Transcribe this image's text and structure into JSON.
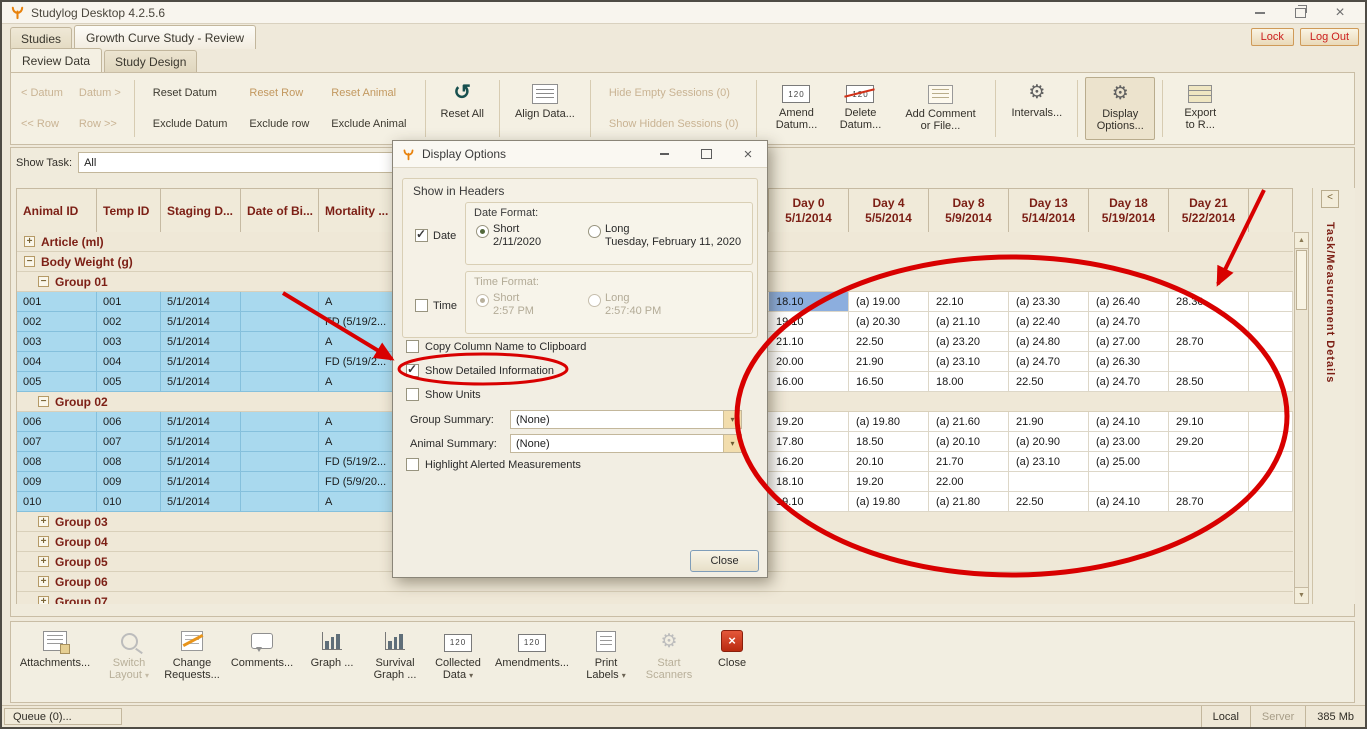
{
  "window": {
    "title": "Studylog Desktop 4.2.5.6"
  },
  "header_tabs": {
    "studies": "Studies",
    "study_review": "Growth Curve Study - Review",
    "lock": "Lock",
    "log_out": "Log Out"
  },
  "view_tabs": {
    "review_data": "Review Data",
    "study_design": "Study Design"
  },
  "toolbar": {
    "datum_prev": "< Datum",
    "datum_next": "Datum >",
    "row_prev": "<< Row",
    "row_next": "Row >>",
    "reset_datum": "Reset Datum",
    "exclude_datum": "Exclude Datum",
    "reset_row": "Reset Row",
    "exclude_row": "Exclude row",
    "reset_animal": "Reset Animal",
    "exclude_animal": "Exclude Animal",
    "reset_all": "Reset All",
    "align_data": "Align Data...",
    "hide_empty_sessions": "Hide Empty Sessions (0)",
    "show_hidden_sessions": "Show Hidden Sessions (0)",
    "amend_datum": "Amend Datum...",
    "delete_datum": "Delete Datum...",
    "add_comment": "Add Comment or File...",
    "intervals": "Intervals...",
    "display_options": "Display Options...",
    "export_to_r": "Export to R..."
  },
  "filter_bar": {
    "label": "Show Task:",
    "value": "All"
  },
  "grid": {
    "left_headers": [
      "Animal ID",
      "Temp ID",
      "Staging D...",
      "Date of Bi...",
      "Mortality ..."
    ],
    "day_headers": [
      {
        "day": "Day 0",
        "date": "5/1/2014"
      },
      {
        "day": "Day 4",
        "date": "5/5/2014"
      },
      {
        "day": "Day 8",
        "date": "5/9/2014"
      },
      {
        "day": "Day 13",
        "date": "5/14/2014"
      },
      {
        "day": "Day 18",
        "date": "5/19/2014"
      },
      {
        "day": "Day 21",
        "date": "5/22/2014"
      }
    ],
    "tasks": [
      {
        "label": "Article (ml)",
        "expanded": false,
        "groups": []
      },
      {
        "label": "Body Weight (g)",
        "expanded": true,
        "groups": [
          {
            "label": "Group 01",
            "expanded": true,
            "animals": [
              {
                "animal_id": "001",
                "temp_id": "001",
                "staging_date": "5/1/2014",
                "birth_date": "",
                "mortality": "A",
                "values": [
                  "18.10",
                  "(a) 19.00",
                  "22.10",
                  "(a) 23.30",
                  "(a) 26.40",
                  "28.30"
                ],
                "selected_col": 0
              },
              {
                "animal_id": "002",
                "temp_id": "002",
                "staging_date": "5/1/2014",
                "birth_date": "",
                "mortality": "FD (5/19/2...",
                "values": [
                  "19.10",
                  "(a) 20.30",
                  "(a) 21.10",
                  "(a) 22.40",
                  "(a) 24.70",
                  ""
                ]
              },
              {
                "animal_id": "003",
                "temp_id": "003",
                "staging_date": "5/1/2014",
                "birth_date": "",
                "mortality": "A",
                "values": [
                  "21.10",
                  "22.50",
                  "(a) 23.20",
                  "(a) 24.80",
                  "(a) 27.00",
                  "28.70"
                ]
              },
              {
                "animal_id": "004",
                "temp_id": "004",
                "staging_date": "5/1/2014",
                "birth_date": "",
                "mortality": "FD (5/19/2...",
                "values": [
                  "20.00",
                  "21.90",
                  "(a) 23.10",
                  "(a) 24.70",
                  "(a) 26.30",
                  ""
                ]
              },
              {
                "animal_id": "005",
                "temp_id": "005",
                "staging_date": "5/1/2014",
                "birth_date": "",
                "mortality": "A",
                "values": [
                  "16.00",
                  "16.50",
                  "18.00",
                  "22.50",
                  "(a) 24.70",
                  "28.50"
                ]
              }
            ]
          },
          {
            "label": "Group 02",
            "expanded": true,
            "animals": [
              {
                "animal_id": "006",
                "temp_id": "006",
                "staging_date": "5/1/2014",
                "birth_date": "",
                "mortality": "A",
                "values": [
                  "19.20",
                  "(a) 19.80",
                  "(a) 21.60",
                  "21.90",
                  "(a) 24.10",
                  "29.10"
                ]
              },
              {
                "animal_id": "007",
                "temp_id": "007",
                "staging_date": "5/1/2014",
                "birth_date": "",
                "mortality": "A",
                "values": [
                  "17.80",
                  "18.50",
                  "(a) 20.10",
                  "(a) 20.90",
                  "(a) 23.00",
                  "29.20"
                ]
              },
              {
                "animal_id": "008",
                "tem_id_note": "",
                "temp_id": "008",
                "staging_date": "5/1/2014",
                "birth_date": "",
                "mortality": "FD (5/19/2...",
                "values": [
                  "16.20",
                  "20.10",
                  "21.70",
                  "(a) 23.10",
                  "(a) 25.00",
                  ""
                ]
              },
              {
                "animal_id": "009",
                "temp_id": "009",
                "staging_date": "5/1/2014",
                "birth_date": "",
                "mortality": "FD (5/9/20...",
                "values": [
                  "18.10",
                  "19.20",
                  "22.00",
                  "",
                  "",
                  ""
                ]
              },
              {
                "animal_id": "010",
                "temp_id": "010",
                "staging_date": "5/1/2014",
                "birth_date": "",
                "mortality": "A",
                "values": [
                  "19.10",
                  "(a) 19.80",
                  "(a) 21.80",
                  "22.50",
                  "(a) 24.10",
                  "28.70"
                ]
              }
            ]
          },
          {
            "label": "Group 03",
            "expanded": false,
            "animals": []
          },
          {
            "label": "Group 04",
            "expanded": false,
            "animals": []
          },
          {
            "label": "Group 05",
            "expanded": false,
            "animals": []
          },
          {
            "label": "Group 06",
            "expanded": false,
            "animals": []
          },
          {
            "label": "Group 07",
            "expanded": false,
            "animals": []
          }
        ]
      }
    ]
  },
  "side_panel": {
    "title": "Task/Measurement Details"
  },
  "dialog": {
    "title": "Display Options",
    "show_in_headers": "Show in Headers",
    "date_checkbox": "Date",
    "date_format_label": "Date Format:",
    "short_label": "Short",
    "long_label": "Long",
    "date_short_value": "2/11/2020",
    "date_long_value": "Tuesday, February 11, 2020",
    "time_checkbox": "Time",
    "time_format_label": "Time Format:",
    "time_short_value": "2:57 PM",
    "time_long_value": "2:57:40 PM",
    "copy_column_name": "Copy Column Name to Clipboard",
    "show_detailed_information": "Show Detailed Information",
    "show_units": "Show Units",
    "group_summary_label": "Group Summary:",
    "group_summary_value": "(None)",
    "animal_summary_label": "Animal Summary:",
    "animal_summary_value": "(None)",
    "highlight_alerted": "Highlight Alerted Measurements",
    "close_button": "Close"
  },
  "bottom_toolbar": [
    {
      "label": "Attachments...",
      "icon": "attachment-icon",
      "disabled": false,
      "dropdown": false
    },
    {
      "label": "Switch Layout",
      "icon": "magnifier-icon",
      "disabled": true,
      "dropdown": true
    },
    {
      "label": "Change Requests...",
      "icon": "change-request-icon",
      "disabled": false,
      "dropdown": false
    },
    {
      "label": "Comments...",
      "icon": "comment-icon",
      "disabled": false,
      "dropdown": false
    },
    {
      "label": "Graph ...",
      "icon": "bar-graph-icon",
      "disabled": false,
      "dropdown": false
    },
    {
      "label": "Survival Graph ...",
      "icon": "bar-graph-icon",
      "disabled": false,
      "dropdown": false
    },
    {
      "label": "Collected Data",
      "icon": "datum-120-icon",
      "disabled": false,
      "dropdown": true
    },
    {
      "label": "Amendments...",
      "icon": "datum-120-icon",
      "disabled": false,
      "dropdown": false
    },
    {
      "label": "Print Labels",
      "icon": "print-icon",
      "disabled": false,
      "dropdown": true
    },
    {
      "label": "Start Scanners",
      "icon": "gear-icon",
      "disabled": true,
      "dropdown": false
    },
    {
      "label": "Close",
      "icon": "close-red-icon",
      "disabled": false,
      "dropdown": false
    }
  ],
  "status_bar": {
    "queue": "Queue (0)...",
    "local": "Local",
    "server": "Server",
    "memory": "385 Mb"
  }
}
